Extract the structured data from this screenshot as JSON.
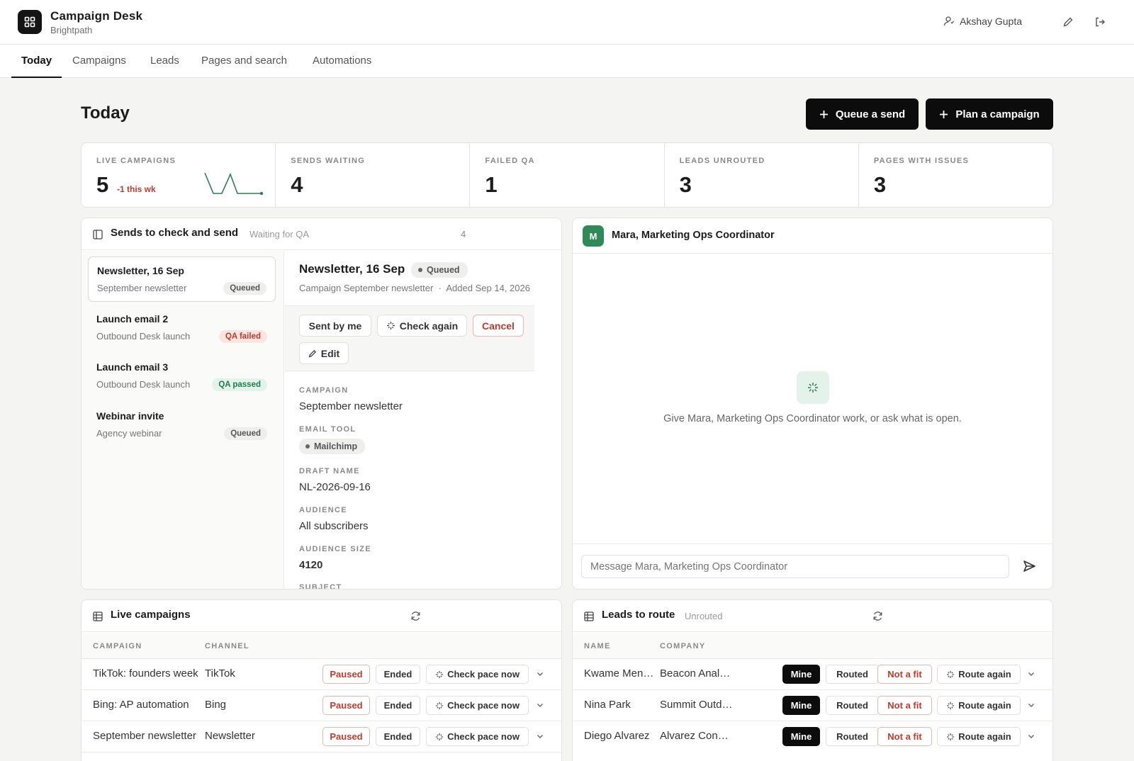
{
  "app": {
    "name": "Campaign Desk",
    "org": "Brightpath",
    "user": "Akshay Gupta"
  },
  "icons": {
    "logo": "grid-icon",
    "user": "user-icon",
    "edit": "pencil-icon",
    "logout": "logout-icon",
    "sparkle": "sparkle-icon",
    "send": "send-icon",
    "refresh": "refresh-icon",
    "table": "table-icon",
    "panel": "panel-icon",
    "chevron": "chevron-down-icon"
  },
  "nav": {
    "tabs": [
      "Today",
      "Campaigns",
      "Leads",
      "Pages and search",
      "Automations"
    ],
    "active": "Today"
  },
  "page": {
    "title": "Today",
    "queue_label": "Queue a send",
    "plan_label": "Plan a campaign"
  },
  "stats": [
    {
      "label": "LIVE CAMPAIGNS",
      "value": "5",
      "delta": "-1 this wk"
    },
    {
      "label": "SENDS WAITING",
      "value": "4"
    },
    {
      "label": "FAILED QA",
      "value": "1"
    },
    {
      "label": "LEADS UNROUTED",
      "value": "3"
    },
    {
      "label": "PAGES WITH ISSUES",
      "value": "3"
    }
  ],
  "sends": {
    "title": "Sends to check and send",
    "subtitle": "Waiting for QA",
    "count": "4",
    "items": [
      {
        "title": "Newsletter, 16 Sep",
        "sub": "September newsletter",
        "status": "Queued"
      },
      {
        "title": "Launch email 2",
        "sub": "Outbound Desk launch",
        "status": "QA failed"
      },
      {
        "title": "Launch email 3",
        "sub": "Outbound Desk launch",
        "status": "QA passed"
      },
      {
        "title": "Webinar invite",
        "sub": "Agency webinar",
        "status": "Queued"
      }
    ],
    "detail": {
      "title": "Newsletter, 16 Sep",
      "status": "Queued",
      "meta_campaign": "Campaign September newsletter",
      "meta_added": "Added Sep 14, 2026",
      "actions": {
        "sent_by_me": "Sent by me",
        "check_again": "Check again",
        "cancel": "Cancel",
        "edit": "Edit"
      },
      "fields": {
        "campaign_label": "CAMPAIGN",
        "campaign": "September newsletter",
        "tool_label": "EMAIL TOOL",
        "tool": "Mailchimp",
        "draft_label": "DRAFT NAME",
        "draft": "NL-2026-09-16",
        "audience_label": "AUDIENCE",
        "audience": "All subscribers",
        "size_label": "AUDIENCE SIZE",
        "size": "4120",
        "subject_label": "SUBJECT"
      }
    }
  },
  "assistant": {
    "avatar": "M",
    "name": "Mara, Marketing Ops Coordinator",
    "empty_text": "Give Mara, Marketing Ops Coordinator work, or ask what is open.",
    "placeholder": "Message Mara, Marketing Ops Coordinator"
  },
  "live_campaigns": {
    "title": "Live campaigns",
    "columns": {
      "campaign": "CAMPAIGN",
      "channel": "CHANNEL"
    },
    "actions": {
      "paused": "Paused",
      "ended": "Ended",
      "check": "Check pace now"
    },
    "rows": [
      {
        "campaign": "TikTok: founders week",
        "channel": "TikTok"
      },
      {
        "campaign": "Bing: AP automation",
        "channel": "Bing"
      },
      {
        "campaign": "September newsletter",
        "channel": "Newsletter"
      }
    ]
  },
  "leads": {
    "title": "Leads to route",
    "subtitle": "Unrouted",
    "columns": {
      "name": "NAME",
      "company": "COMPANY"
    },
    "actions": {
      "mine": "Mine",
      "routed": "Routed",
      "not_fit": "Not a fit",
      "route_again": "Route again"
    },
    "rows": [
      {
        "name": "Kwame Mensah",
        "company": "Beacon Analytics"
      },
      {
        "name": "Nina Park",
        "company": "Summit Outdoors"
      },
      {
        "name": "Diego Alvarez",
        "company": "Alvarez Consulting"
      }
    ]
  },
  "colors": {
    "accent": "#0c0c0c",
    "danger": "#c23a2c",
    "success": "#1f7a4d",
    "avatar": "#2f8a57"
  }
}
